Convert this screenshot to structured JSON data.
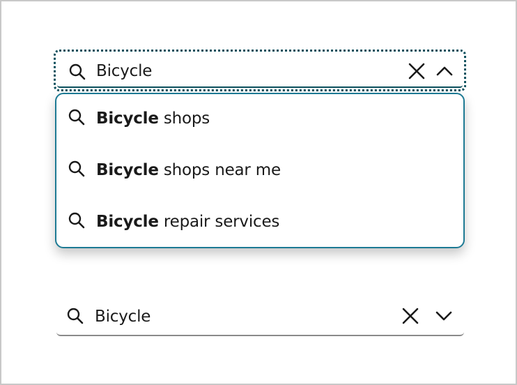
{
  "expanded_combobox": {
    "value": "Bicycle",
    "clear_label": "Clear",
    "toggle_label": "Collapse"
  },
  "suggestions": [
    {
      "match": "Bicycle",
      "rest": " shops"
    },
    {
      "match": "Bicycle",
      "rest": " shops near me"
    },
    {
      "match": "Bicycle",
      "rest": " repair services"
    }
  ],
  "collapsed_combobox": {
    "value": "Bicycle",
    "clear_label": "Clear",
    "toggle_label": "Expand"
  },
  "colors": {
    "focus_ring": "#0b4f5c",
    "listbox_border": "#1d7a94",
    "underline_collapsed": "#8a8a8a"
  },
  "icons": [
    "search-icon",
    "close-icon",
    "chevron-up-icon",
    "chevron-down-icon"
  ]
}
